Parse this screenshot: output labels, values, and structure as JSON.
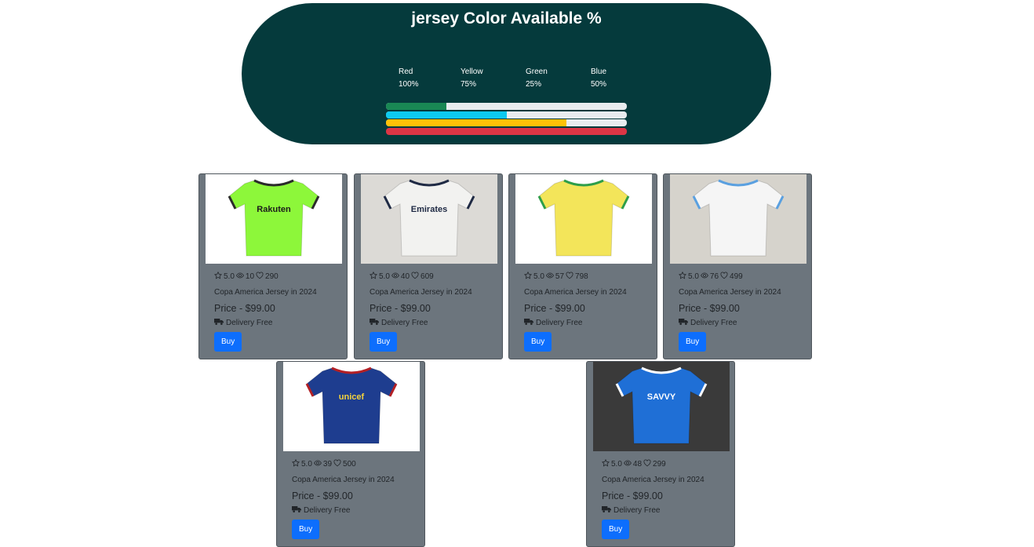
{
  "banner": {
    "title": "jersey Color Available %",
    "legend": [
      {
        "color_name": "Red",
        "percent": "100%"
      },
      {
        "color_name": "Yellow",
        "percent": "75%"
      },
      {
        "color_name": "Green",
        "percent": "25%"
      },
      {
        "color_name": "Blue",
        "percent": "50%"
      }
    ],
    "bars": [
      {
        "name": "green",
        "fill": 0.25,
        "color": "#198754"
      },
      {
        "name": "blue",
        "fill": 0.5,
        "color": "#0dcaf0"
      },
      {
        "name": "yellow",
        "fill": 0.75,
        "color": "#ffc107"
      },
      {
        "name": "red",
        "fill": 1.0,
        "color": "#dc3545"
      }
    ]
  },
  "products": [
    {
      "rating": "5.0",
      "views": "10",
      "likes": "290",
      "title": "Copa America Jersey in 2024",
      "price": "Price - $99.00",
      "delivery": "Delivery Free",
      "buy_label": "Buy",
      "shirt": {
        "primary": "#8df73a",
        "secondary": "#2b2b2b",
        "text": "Rakuten",
        "text_color": "#1c1c1c",
        "bg": "#ffffff"
      }
    },
    {
      "rating": "5.0",
      "views": "40",
      "likes": "609",
      "title": "Copa America Jersey in 2024",
      "price": "Price - $99.00",
      "delivery": "Delivery Free",
      "buy_label": "Buy",
      "shirt": {
        "primary": "#f2f2f0",
        "secondary": "#1f2a44",
        "text": "Emirates",
        "text_color": "#1f2a44",
        "bg": "#dcdad6"
      }
    },
    {
      "rating": "5.0",
      "views": "57",
      "likes": "798",
      "title": "Copa America Jersey in 2024",
      "price": "Price - $99.00",
      "delivery": "Delivery Free",
      "buy_label": "Buy",
      "shirt": {
        "primary": "#f3e55a",
        "secondary": "#2e9e4a",
        "text": "",
        "text_color": "#1d6f3a",
        "bg": "#ffffff"
      }
    },
    {
      "rating": "5.0",
      "views": "76",
      "likes": "499",
      "title": "Copa America Jersey in 2024",
      "price": "Price - $99.00",
      "delivery": "Delivery Free",
      "buy_label": "Buy",
      "shirt": {
        "primary": "#f5f5f5",
        "secondary": "#5aa0e0",
        "text": "",
        "text_color": "#1f3f7a",
        "bg": "#d6d3cc"
      }
    },
    {
      "rating": "5.0",
      "views": "39",
      "likes": "500",
      "title": "Copa America Jersey in 2024",
      "price": "Price - $99.00",
      "delivery": "Delivery Free",
      "buy_label": "Buy",
      "shirt": {
        "primary": "#1e3d8f",
        "secondary": "#b32025",
        "text": "unicef",
        "text_color": "#f4d23b",
        "bg": "#ffffff"
      }
    },
    {
      "rating": "5.0",
      "views": "48",
      "likes": "299",
      "title": "Copa America Jersey in 2024",
      "price": "Price - $99.00",
      "delivery": "Delivery Free",
      "buy_label": "Buy",
      "shirt": {
        "primary": "#1f6fd6",
        "secondary": "#ffffff",
        "text": "SAVVY",
        "text_color": "#ffffff",
        "bg": "#3a3a3a"
      }
    }
  ]
}
